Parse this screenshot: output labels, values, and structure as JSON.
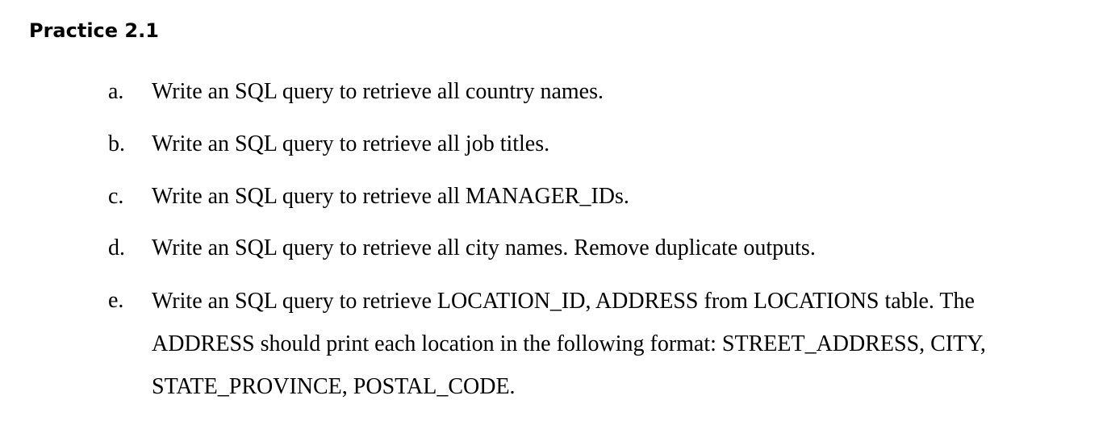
{
  "document": {
    "title": "Practice 2.1",
    "items": [
      {
        "marker": "a.",
        "lines": [
          "Write an SQL query to retrieve all country names."
        ]
      },
      {
        "marker": "b.",
        "lines": [
          "Write an SQL query to retrieve all job titles."
        ]
      },
      {
        "marker": "c.",
        "lines": [
          "Write an SQL query to retrieve all MANAGER_IDs."
        ]
      },
      {
        "marker": "d.",
        "lines": [
          "Write an SQL query to retrieve all city names. Remove duplicate outputs."
        ]
      },
      {
        "marker": "e.",
        "lines": [
          "Write an SQL query to retrieve LOCATION_ID, ADDRESS from LOCATIONS table. The",
          "ADDRESS should print each location in the following format: STREET_ADDRESS, CITY,",
          "STATE_PROVINCE, POSTAL_CODE."
        ]
      }
    ]
  }
}
